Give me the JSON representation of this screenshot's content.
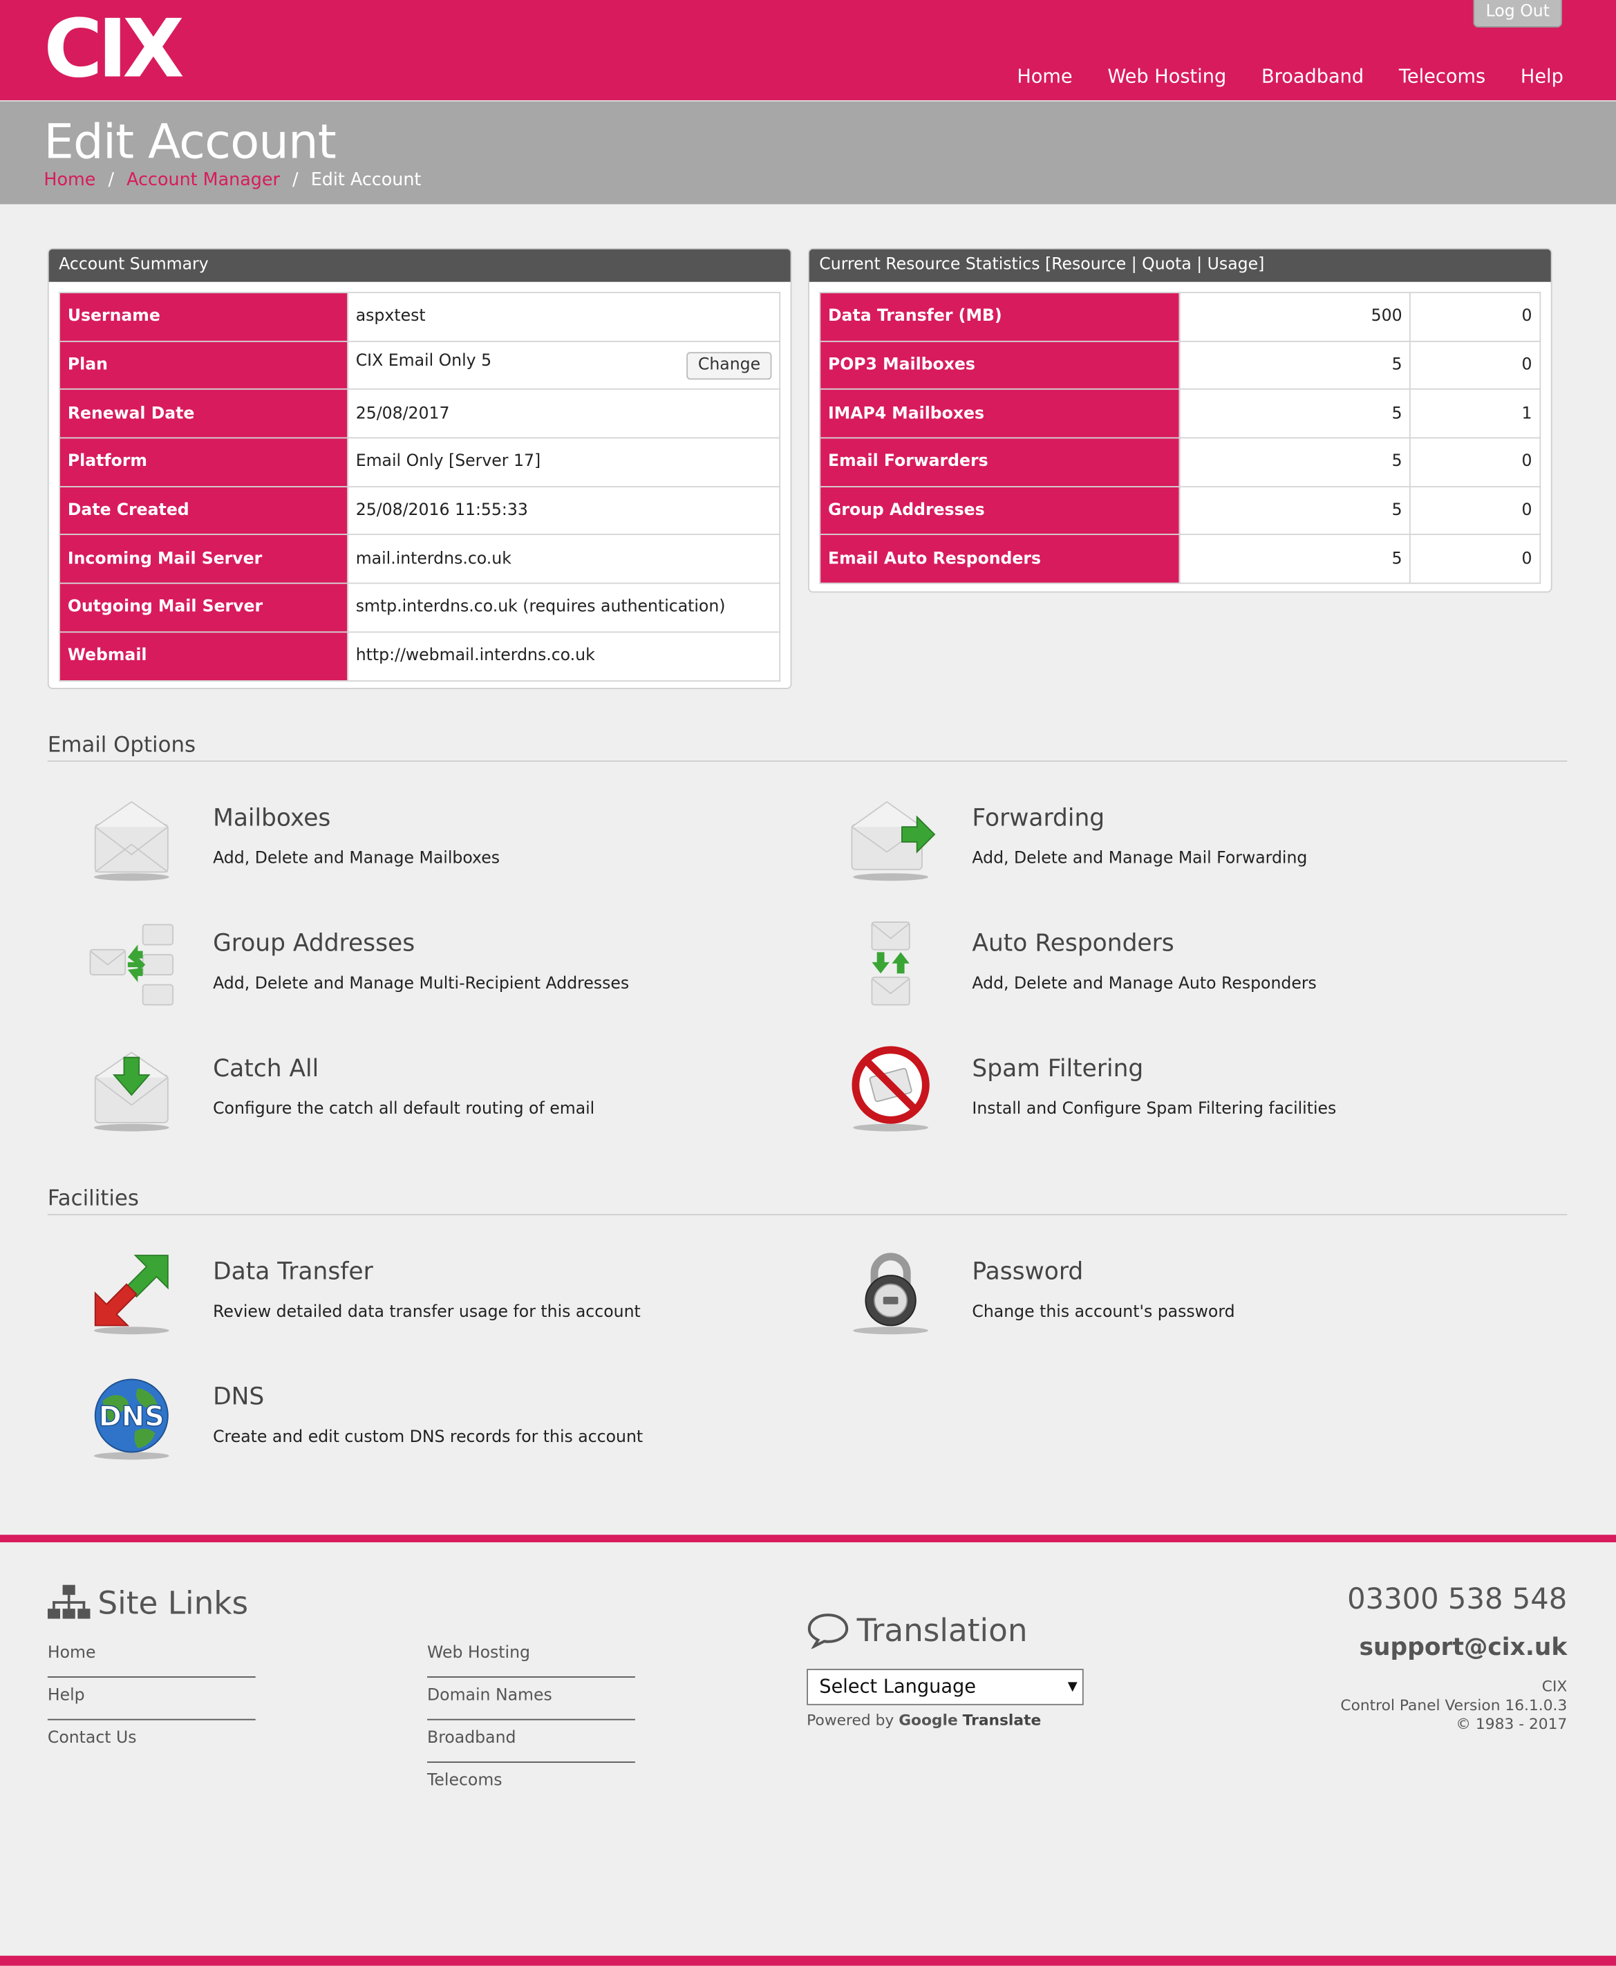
{
  "header": {
    "logo": "CIX",
    "logout": "Log Out",
    "nav": [
      "Home",
      "Web Hosting",
      "Broadband",
      "Telecoms",
      "Help"
    ]
  },
  "title": {
    "page_title": "Edit Account",
    "breadcrumb": [
      "Home",
      "Account Manager",
      "Edit Account"
    ],
    "breadcrumb_separator": "/"
  },
  "account_summary": {
    "heading": "Account Summary",
    "change_label": "Change",
    "rows": [
      {
        "label": "Username",
        "value": "aspxtest"
      },
      {
        "label": "Plan",
        "value": "CIX Email Only 5"
      },
      {
        "label": "Renewal Date",
        "value": "25/08/2017"
      },
      {
        "label": "Platform",
        "value": "Email Only [Server 17]"
      },
      {
        "label": "Date Created",
        "value": "25/08/2016 11:55:33"
      },
      {
        "label": "Incoming Mail Server",
        "value": "mail.interdns.co.uk"
      },
      {
        "label": "Outgoing Mail Server",
        "value": "smtp.interdns.co.uk (requires authentication)"
      },
      {
        "label": "Webmail",
        "value": "http://webmail.interdns.co.uk"
      }
    ]
  },
  "resources": {
    "heading": "Current Resource Statistics [Resource | Quota | Usage]",
    "rows": [
      {
        "resource": "Data Transfer (MB)",
        "quota": "500",
        "usage": "0"
      },
      {
        "resource": "POP3 Mailboxes",
        "quota": "5",
        "usage": "0"
      },
      {
        "resource": "IMAP4 Mailboxes",
        "quota": "5",
        "usage": "1"
      },
      {
        "resource": "Email Forwarders",
        "quota": "5",
        "usage": "0"
      },
      {
        "resource": "Group Addresses",
        "quota": "5",
        "usage": "0"
      },
      {
        "resource": "Email Auto Responders",
        "quota": "5",
        "usage": "0"
      }
    ]
  },
  "email_options": {
    "heading": "Email Options",
    "items": [
      {
        "title": "Mailboxes",
        "desc": "Add, Delete and Manage Mailboxes",
        "icon": "envelope-icon"
      },
      {
        "title": "Forwarding",
        "desc": "Add, Delete and Manage Mail Forwarding",
        "icon": "envelope-forward-icon"
      },
      {
        "title": "Group Addresses",
        "desc": "Add, Delete and Manage Multi-Recipient Addresses",
        "icon": "group-envelopes-icon"
      },
      {
        "title": "Auto Responders",
        "desc": "Add, Delete and Manage Auto Responders",
        "icon": "auto-responder-icon"
      },
      {
        "title": "Catch All",
        "desc": "Configure the catch all default routing of email",
        "icon": "catch-all-icon"
      },
      {
        "title": "Spam Filtering",
        "desc": "Install and Configure Spam Filtering facilities",
        "icon": "no-spam-icon"
      }
    ]
  },
  "facilities": {
    "heading": "Facilities",
    "items": [
      {
        "title": "Data Transfer",
        "desc": "Review detailed data transfer usage for this account",
        "icon": "transfer-arrows-icon"
      },
      {
        "title": "Password",
        "desc": "Change this account's password",
        "icon": "padlock-icon"
      },
      {
        "title": "DNS",
        "desc": "Create and edit custom DNS records for this account",
        "icon": "dns-globe-icon",
        "icon_text": "DNS"
      }
    ]
  },
  "footer": {
    "site_links_heading": "Site Links",
    "links_col1": [
      "Home",
      "Help",
      "Contact Us"
    ],
    "links_col2": [
      "Web Hosting",
      "Domain Names",
      "Broadband",
      "Telecoms"
    ],
    "translation_heading": "Translation",
    "language_select": "Select Language",
    "powered_by": "Powered by",
    "google": "Google",
    "translate": "Translate",
    "phone": "03300 538 548",
    "email": "support@cix.uk",
    "company": "CIX",
    "version": "Control Panel Version 16.1.0.3",
    "copyright": "© 1983 - 2017"
  },
  "colors": {
    "brand": "#d81b5c",
    "title_bar": "#a7a7a7",
    "panel_header": "#555555"
  }
}
